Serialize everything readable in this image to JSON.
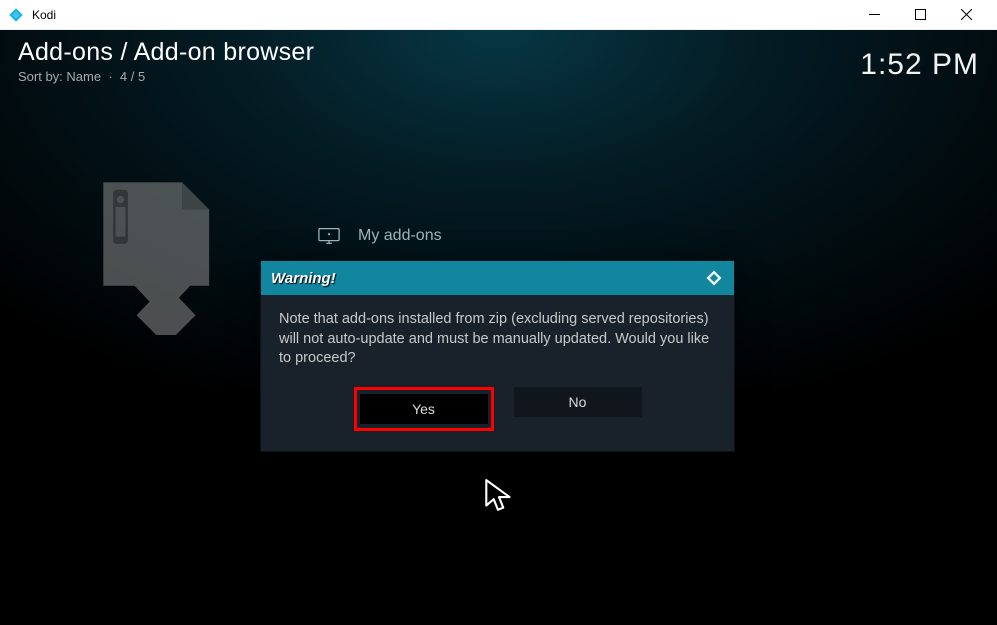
{
  "window": {
    "title": "Kodi"
  },
  "header": {
    "breadcrumb": "Add-ons / Add-on browser",
    "sort_label": "Sort by: Name",
    "position": "4 / 5"
  },
  "clock": "1:52 PM",
  "main": {
    "list_item_label": "My add-ons"
  },
  "dialog": {
    "title": "Warning!",
    "message": "Note that add-ons installed from zip (excluding served repositories) will not auto-update and must be manually updated. Would you like to proceed?",
    "yes_label": "Yes",
    "no_label": "No"
  }
}
